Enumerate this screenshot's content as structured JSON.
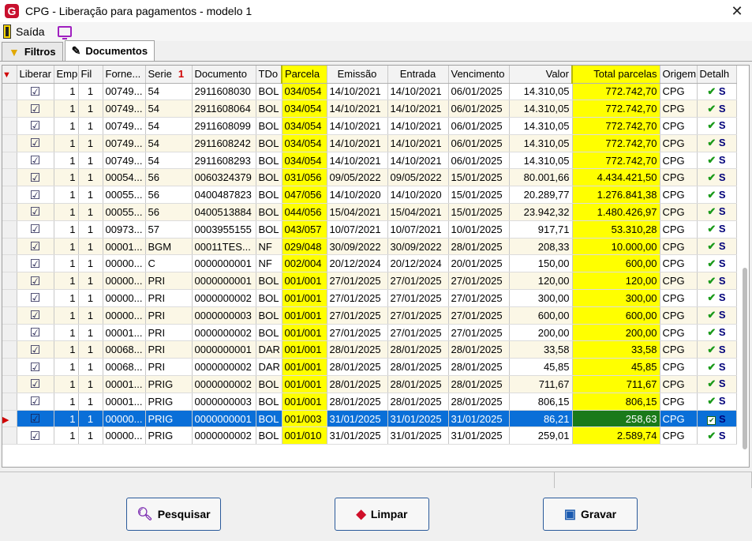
{
  "window": {
    "title": "CPG - Liberação para pagamentos - modelo 1",
    "close": "✕"
  },
  "menu": {
    "exit_label": "Saída"
  },
  "tabs": [
    {
      "label": "Filtros"
    },
    {
      "label": "Documentos"
    }
  ],
  "columns": [
    "Liberar",
    "Emp",
    "Fil",
    "Forne...",
    "Serie",
    "Documento",
    "TDo",
    "Parcela",
    "Emissão",
    "Entrada",
    "Vencimento",
    "Valor",
    "Total parcelas",
    "Origem",
    "Detalh"
  ],
  "sort_marker": "1",
  "rows": [
    {
      "emp": "1",
      "fil": "1",
      "forn": "00749...",
      "serie": "54",
      "doc": "2911608030",
      "tdo": "BOL",
      "parcela": "034/054",
      "emissao": "14/10/2021",
      "entrada": "14/10/2021",
      "venc": "06/01/2025",
      "valor": "14.310,05",
      "total": "772.742,70",
      "origem": "CPG",
      "det": "S"
    },
    {
      "emp": "1",
      "fil": "1",
      "forn": "00749...",
      "serie": "54",
      "doc": "2911608064",
      "tdo": "BOL",
      "parcela": "034/054",
      "emissao": "14/10/2021",
      "entrada": "14/10/2021",
      "venc": "06/01/2025",
      "valor": "14.310,05",
      "total": "772.742,70",
      "origem": "CPG",
      "det": "S"
    },
    {
      "emp": "1",
      "fil": "1",
      "forn": "00749...",
      "serie": "54",
      "doc": "2911608099",
      "tdo": "BOL",
      "parcela": "034/054",
      "emissao": "14/10/2021",
      "entrada": "14/10/2021",
      "venc": "06/01/2025",
      "valor": "14.310,05",
      "total": "772.742,70",
      "origem": "CPG",
      "det": "S"
    },
    {
      "emp": "1",
      "fil": "1",
      "forn": "00749...",
      "serie": "54",
      "doc": "2911608242",
      "tdo": "BOL",
      "parcela": "034/054",
      "emissao": "14/10/2021",
      "entrada": "14/10/2021",
      "venc": "06/01/2025",
      "valor": "14.310,05",
      "total": "772.742,70",
      "origem": "CPG",
      "det": "S"
    },
    {
      "emp": "1",
      "fil": "1",
      "forn": "00749...",
      "serie": "54",
      "doc": "2911608293",
      "tdo": "BOL",
      "parcela": "034/054",
      "emissao": "14/10/2021",
      "entrada": "14/10/2021",
      "venc": "06/01/2025",
      "valor": "14.310,05",
      "total": "772.742,70",
      "origem": "CPG",
      "det": "S"
    },
    {
      "emp": "1",
      "fil": "1",
      "forn": "00054...",
      "serie": "56",
      "doc": "0060324379",
      "tdo": "BOL",
      "parcela": "031/056",
      "emissao": "09/05/2022",
      "entrada": "09/05/2022",
      "venc": "15/01/2025",
      "valor": "80.001,66",
      "total": "4.434.421,50",
      "origem": "CPG",
      "det": "S"
    },
    {
      "emp": "1",
      "fil": "1",
      "forn": "00055...",
      "serie": "56",
      "doc": "0400487823",
      "tdo": "BOL",
      "parcela": "047/056",
      "emissao": "14/10/2020",
      "entrada": "14/10/2020",
      "venc": "15/01/2025",
      "valor": "20.289,77",
      "total": "1.276.841,38",
      "origem": "CPG",
      "det": "S"
    },
    {
      "emp": "1",
      "fil": "1",
      "forn": "00055...",
      "serie": "56",
      "doc": "0400513884",
      "tdo": "BOL",
      "parcela": "044/056",
      "emissao": "15/04/2021",
      "entrada": "15/04/2021",
      "venc": "15/01/2025",
      "valor": "23.942,32",
      "total": "1.480.426,97",
      "origem": "CPG",
      "det": "S"
    },
    {
      "emp": "1",
      "fil": "1",
      "forn": "00973...",
      "serie": "57",
      "doc": "0003955155",
      "tdo": "BOL",
      "parcela": "043/057",
      "emissao": "10/07/2021",
      "entrada": "10/07/2021",
      "venc": "10/01/2025",
      "valor": "917,71",
      "total": "53.310,28",
      "origem": "CPG",
      "det": "S"
    },
    {
      "emp": "1",
      "fil": "1",
      "forn": "00001...",
      "serie": "BGM",
      "doc": "00011TES...",
      "tdo": "NF",
      "parcela": "029/048",
      "emissao": "30/09/2022",
      "entrada": "30/09/2022",
      "venc": "28/01/2025",
      "valor": "208,33",
      "total": "10.000,00",
      "origem": "CPG",
      "det": "S"
    },
    {
      "emp": "1",
      "fil": "1",
      "forn": "00000...",
      "serie": "C",
      "doc": "0000000001",
      "tdo": "NF",
      "parcela": "002/004",
      "emissao": "20/12/2024",
      "entrada": "20/12/2024",
      "venc": "20/01/2025",
      "valor": "150,00",
      "total": "600,00",
      "origem": "CPG",
      "det": "S"
    },
    {
      "emp": "1",
      "fil": "1",
      "forn": "00000...",
      "serie": "PRI",
      "doc": "0000000001",
      "tdo": "BOL",
      "parcela": "001/001",
      "emissao": "27/01/2025",
      "entrada": "27/01/2025",
      "venc": "27/01/2025",
      "valor": "120,00",
      "total": "120,00",
      "origem": "CPG",
      "det": "S"
    },
    {
      "emp": "1",
      "fil": "1",
      "forn": "00000...",
      "serie": "PRI",
      "doc": "0000000002",
      "tdo": "BOL",
      "parcela": "001/001",
      "emissao": "27/01/2025",
      "entrada": "27/01/2025",
      "venc": "27/01/2025",
      "valor": "300,00",
      "total": "300,00",
      "origem": "CPG",
      "det": "S"
    },
    {
      "emp": "1",
      "fil": "1",
      "forn": "00000...",
      "serie": "PRI",
      "doc": "0000000003",
      "tdo": "BOL",
      "parcela": "001/001",
      "emissao": "27/01/2025",
      "entrada": "27/01/2025",
      "venc": "27/01/2025",
      "valor": "600,00",
      "total": "600,00",
      "origem": "CPG",
      "det": "S"
    },
    {
      "emp": "1",
      "fil": "1",
      "forn": "00001...",
      "serie": "PRI",
      "doc": "0000000002",
      "tdo": "BOL",
      "parcela": "001/001",
      "emissao": "27/01/2025",
      "entrada": "27/01/2025",
      "venc": "27/01/2025",
      "valor": "200,00",
      "total": "200,00",
      "origem": "CPG",
      "det": "S"
    },
    {
      "emp": "1",
      "fil": "1",
      "forn": "00068...",
      "serie": "PRI",
      "doc": "0000000001",
      "tdo": "DAR",
      "parcela": "001/001",
      "emissao": "28/01/2025",
      "entrada": "28/01/2025",
      "venc": "28/01/2025",
      "valor": "33,58",
      "total": "33,58",
      "origem": "CPG",
      "det": "S"
    },
    {
      "emp": "1",
      "fil": "1",
      "forn": "00068...",
      "serie": "PRI",
      "doc": "0000000002",
      "tdo": "DAR",
      "parcela": "001/001",
      "emissao": "28/01/2025",
      "entrada": "28/01/2025",
      "venc": "28/01/2025",
      "valor": "45,85",
      "total": "45,85",
      "origem": "CPG",
      "det": "S"
    },
    {
      "emp": "1",
      "fil": "1",
      "forn": "00001...",
      "serie": "PRIG",
      "doc": "0000000002",
      "tdo": "BOL",
      "parcela": "001/001",
      "emissao": "28/01/2025",
      "entrada": "28/01/2025",
      "venc": "28/01/2025",
      "valor": "711,67",
      "total": "711,67",
      "origem": "CPG",
      "det": "S"
    },
    {
      "emp": "1",
      "fil": "1",
      "forn": "00001...",
      "serie": "PRIG",
      "doc": "0000000003",
      "tdo": "BOL",
      "parcela": "001/001",
      "emissao": "28/01/2025",
      "entrada": "28/01/2025",
      "venc": "28/01/2025",
      "valor": "806,15",
      "total": "806,15",
      "origem": "CPG",
      "det": "S"
    },
    {
      "emp": "1",
      "fil": "1",
      "forn": "00000...",
      "serie": "PRIG",
      "doc": "0000000001",
      "tdo": "BOL",
      "parcela": "001/003",
      "emissao": "31/01/2025",
      "entrada": "31/01/2025",
      "venc": "31/01/2025",
      "valor": "86,21",
      "total": "258,63",
      "origem": "CPG",
      "det": "S",
      "selected": true
    },
    {
      "emp": "1",
      "fil": "1",
      "forn": "00000...",
      "serie": "PRIG",
      "doc": "0000000002",
      "tdo": "BOL",
      "parcela": "001/010",
      "emissao": "31/01/2025",
      "entrada": "31/01/2025",
      "venc": "31/01/2025",
      "valor": "259,01",
      "total": "2.589,74",
      "origem": "CPG",
      "det": "S"
    }
  ],
  "buttons": {
    "search": "Pesquisar",
    "clear": "Limpar",
    "save": "Gravar"
  },
  "colors": {
    "highlight": "#ffff00",
    "selected_row": "#0a6fd8",
    "selected_total": "#1a7a1a"
  }
}
